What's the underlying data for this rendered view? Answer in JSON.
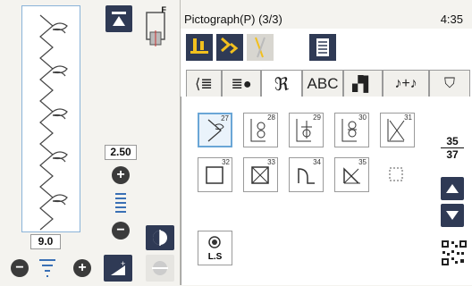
{
  "header": {
    "title": "Pictograph(P) (3/3)",
    "clock": "4:35"
  },
  "presser_foot": {
    "label": "F"
  },
  "stitch_width": {
    "value": "2.50"
  },
  "stitch_length": {
    "value": "9.0"
  },
  "tabs": [
    {
      "label": "",
      "icon": "utility-stitch-icon"
    },
    {
      "label": "",
      "icon": "bead-stitch-icon"
    },
    {
      "label": "",
      "icon": "decorative-stitch-icon"
    },
    {
      "label": "ABC",
      "icon": ""
    },
    {
      "label": "",
      "icon": "satin-stitch-icon"
    },
    {
      "label": "",
      "icon": "cross-stitch-icon"
    },
    {
      "label": "",
      "icon": "tshirt-icon"
    }
  ],
  "patterns": [
    {
      "num": "27",
      "icon": "hand-pattern-icon",
      "selected": true
    },
    {
      "num": "28",
      "icon": "figure8-pattern-icon"
    },
    {
      "num": "29",
      "icon": "cross-pattern-icon"
    },
    {
      "num": "30",
      "icon": "double-figure8-pattern-icon"
    },
    {
      "num": "31",
      "icon": "x-pattern-icon"
    },
    {
      "num": "32",
      "icon": "square-circle-pattern-icon"
    },
    {
      "num": "33",
      "icon": "square-x-pattern-icon"
    },
    {
      "num": "34",
      "icon": "arch-pattern-icon"
    },
    {
      "num": "35",
      "icon": "arch-x-pattern-icon"
    },
    {
      "num": "",
      "icon": "empty-pattern-icon"
    }
  ],
  "ls_button": {
    "label": "L.S"
  },
  "pagination": {
    "current": "35",
    "total": "37"
  },
  "colors": {
    "accent": "#2f3a55",
    "highlight": "#6aa6d6",
    "yellow": "#f2c01e",
    "stitch": "#3a70b5"
  }
}
